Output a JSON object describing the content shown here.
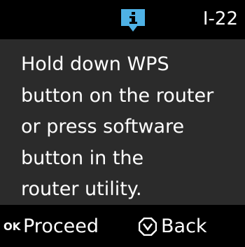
{
  "header": {
    "icon": "info-icon",
    "code": "I-22"
  },
  "message": {
    "text": "Hold down WPS\nbutton on the router\nor press software\nbutton in the\nrouter utility."
  },
  "footer": {
    "ok_key": "OK",
    "proceed_label": "Proceed",
    "back_icon": "stop-icon",
    "back_label": "Back"
  },
  "colors": {
    "background": "#000000",
    "panel": "#2b2b2b",
    "text": "#ffffff",
    "info_accent": "#4fb2e6"
  }
}
